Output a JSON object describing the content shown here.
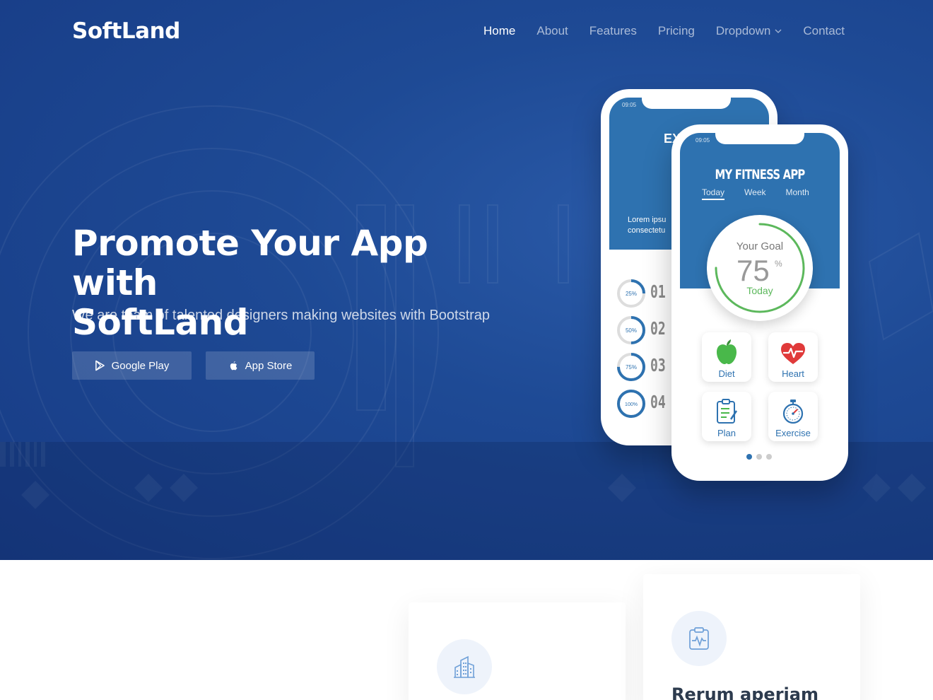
{
  "brand": {
    "name": "SoftLand"
  },
  "nav": {
    "items": [
      {
        "label": "Home",
        "active": true
      },
      {
        "label": "About",
        "active": false
      },
      {
        "label": "Features",
        "active": false
      },
      {
        "label": "Pricing",
        "active": false
      },
      {
        "label": "Dropdown",
        "active": false,
        "has_submenu": true
      },
      {
        "label": "Contact",
        "active": false
      }
    ]
  },
  "hero": {
    "title_line1": "Promote Your App with",
    "title_line2": "SoftLand",
    "subtitle": "We are team of talented designers making websites with Bootstrap",
    "buttons": [
      {
        "label": "Google Play",
        "icon": "google-play-icon"
      },
      {
        "label": "App Store",
        "icon": "apple-icon"
      }
    ]
  },
  "phone_front": {
    "time": "09:05",
    "app_title": "MY FITNESS APP",
    "tabs": [
      "Today",
      "Week",
      "Month"
    ],
    "selected_tab": "Today",
    "goal_label": "Your Goal",
    "goal_value": "75",
    "goal_unit": "%",
    "goal_period": "Today",
    "goal_progress": 0.75,
    "tiles": [
      {
        "label": "Diet",
        "icon": "apple-fruit-icon"
      },
      {
        "label": "Heart",
        "icon": "heart-icon"
      },
      {
        "label": "Plan",
        "icon": "clipboard-icon"
      },
      {
        "label": "Exercise",
        "icon": "stopwatch-icon"
      }
    ],
    "page_dots": 3,
    "active_dot": 0
  },
  "phone_back": {
    "time": "09:05",
    "title_partial": "EX",
    "text_partial_1": "Lorem ipsu",
    "text_partial_2": "consectetu",
    "steps": [
      {
        "percent": "25%",
        "num": "01",
        "progress": 0.25
      },
      {
        "percent": "50%",
        "num": "02",
        "progress": 0.5
      },
      {
        "percent": "75%",
        "num": "03",
        "progress": 0.75
      },
      {
        "percent": "100%",
        "num": "04",
        "progress": 1.0
      }
    ]
  },
  "cards": [
    {
      "icon": "building-icon",
      "title": ""
    },
    {
      "icon": "clipboard-pulse-icon",
      "title": "Rerum aperiam"
    }
  ],
  "colors": {
    "hero_bg": "#1e4a95",
    "phone_accent": "#2e72b0",
    "goal_green": "#5cb85c",
    "card_title": "#2d3b4e"
  }
}
